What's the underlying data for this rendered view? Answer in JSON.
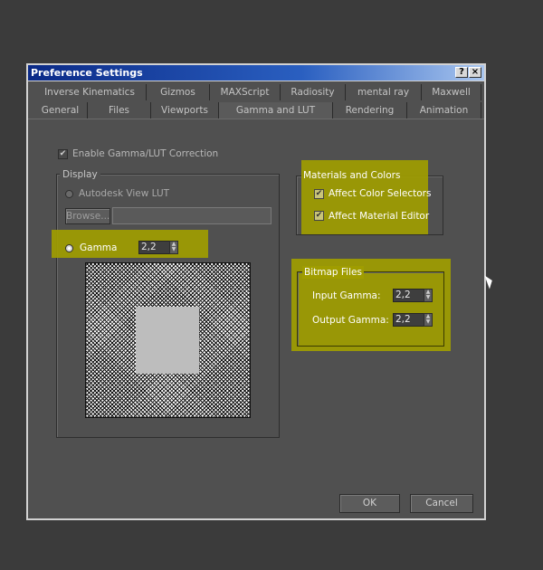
{
  "window": {
    "title": "Preference Settings",
    "help_btn": "?",
    "close_btn": "×"
  },
  "tabs_row1": [
    "Inverse Kinematics",
    "Gizmos",
    "MAXScript",
    "Radiosity",
    "mental ray",
    "Maxwell"
  ],
  "tabs_row2": [
    "General",
    "Files",
    "Viewports",
    "Gamma and LUT",
    "Rendering",
    "Animation"
  ],
  "active_tab": "Gamma and LUT",
  "enable_gamma": {
    "label": "Enable Gamma/LUT Correction",
    "checked": true
  },
  "display": {
    "legend": "Display",
    "lut_label": "Autodesk View LUT",
    "browse_label": "Browse...",
    "lut_path": "",
    "gamma_label": "Gamma",
    "gamma_value": "2,2"
  },
  "materials": {
    "legend": "Materials and Colors",
    "color_selectors": "Affect Color Selectors",
    "material_editor": "Affect Material Editor"
  },
  "bitmap": {
    "legend": "Bitmap Files",
    "input_label": "Input Gamma:",
    "input_value": "2,2",
    "output_label": "Output Gamma:",
    "output_value": "2,2"
  },
  "buttons": {
    "ok": "OK",
    "cancel": "Cancel"
  },
  "colors": {
    "highlight": "#a09d00",
    "title_start": "#0b2a87",
    "title_end": "#a9c6ef"
  }
}
